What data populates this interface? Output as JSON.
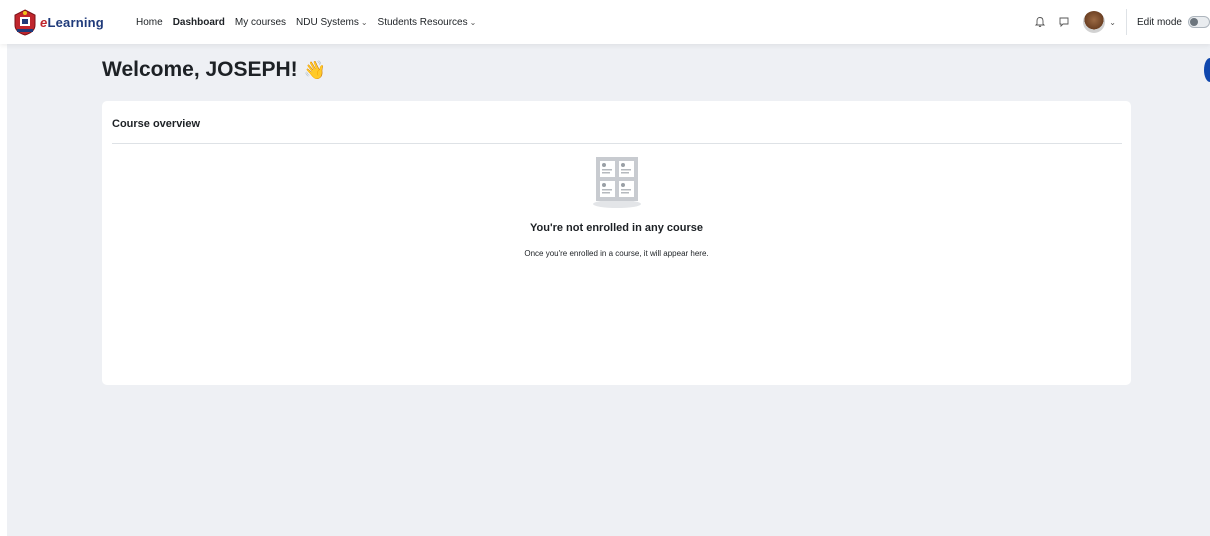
{
  "brand": {
    "name_prefix": "e",
    "name_rest": "Learning"
  },
  "nav": {
    "links": [
      {
        "label": "Home"
      },
      {
        "label": "Dashboard"
      },
      {
        "label": "My courses"
      },
      {
        "label": "NDU Systems"
      },
      {
        "label": "Students Resources"
      }
    ],
    "edit_mode_label": "Edit mode",
    "edit_mode_on": false
  },
  "icons": {
    "notifications": "bell-icon",
    "messages": "chat-icon",
    "user_menu": "chevron-down-icon"
  },
  "page": {
    "welcome": "Welcome, JOSEPH!",
    "wave": "👋"
  },
  "course_overview": {
    "title": "Course overview",
    "empty_title": "You're not enrolled in any course",
    "empty_text": "Once you're enrolled in a course, it will appear here."
  },
  "colors": {
    "page_bg": "#eef0f4",
    "brand_blue": "#1f3a7a",
    "brand_red": "#c0262d",
    "accent": "#0f47ad"
  }
}
